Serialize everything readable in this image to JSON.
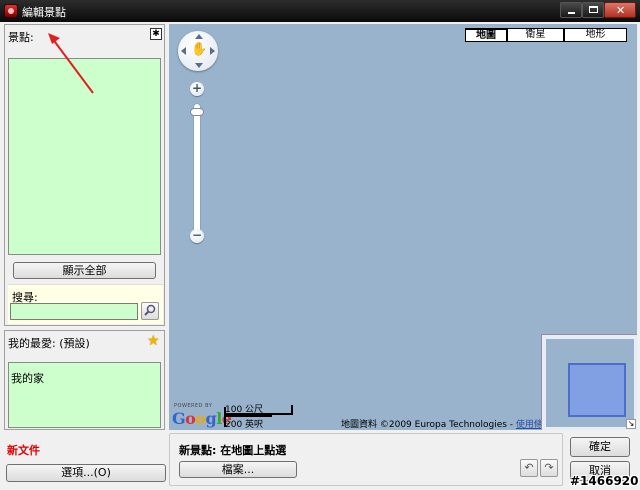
{
  "window": {
    "title": "編輯景點"
  },
  "spots_panel": {
    "label": "景點:",
    "show_all_button": "顯示全部",
    "search_label": "搜尋:",
    "search_value": ""
  },
  "favorites_panel": {
    "label": "我的最愛: (預設)",
    "items": [
      "我的家"
    ]
  },
  "map": {
    "type_buttons": [
      "地圖",
      "衛星",
      "地形"
    ],
    "selected_type": "地圖",
    "scale_metric": "100 公尺",
    "scale_imperial": "200 英呎",
    "powered_by": "POWERED BY",
    "logo_text": "Google",
    "copyright_text": "地圖資料 ©2009 Europa Technologies - ",
    "terms_link": "使用條款"
  },
  "bottom": {
    "new_file_label": "新文件",
    "options_button": "選項...(O)",
    "new_spot_label": "新景點: 在地圖上點選",
    "file_button": "檔案...",
    "ok_button": "確定",
    "cancel_button": "取消"
  },
  "watermark": "#1466920",
  "colors": {
    "list_background": "#ccffcc",
    "map_water": "#99b3cc",
    "new_file_text": "#e00000",
    "annotation_arrow": "#e02020"
  }
}
